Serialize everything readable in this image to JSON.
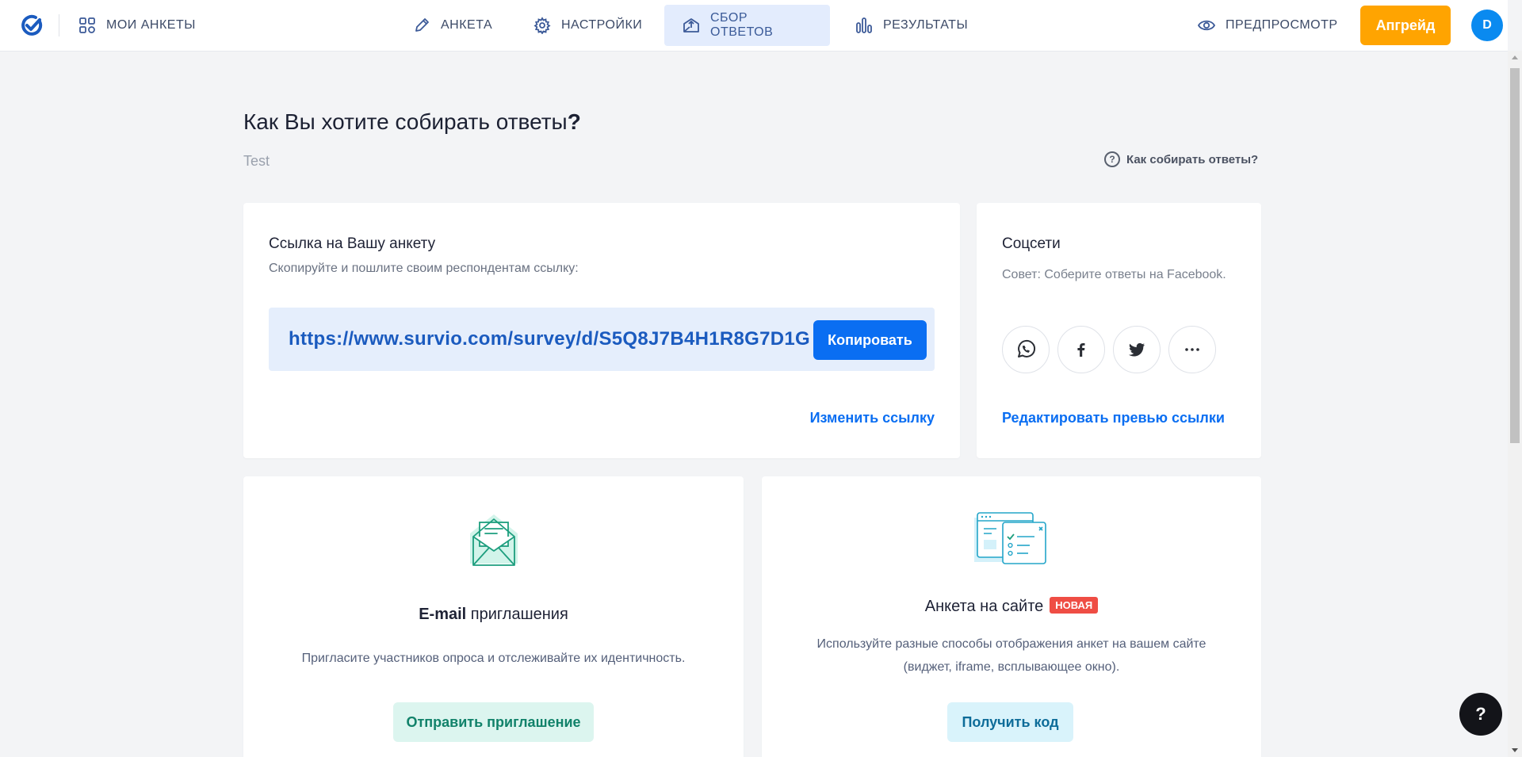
{
  "nav": {
    "my_surveys": "МОИ АНКЕТЫ",
    "tabs": [
      {
        "label": "АНКЕТА"
      },
      {
        "label": "НАСТРОЙКИ"
      },
      {
        "label": "СБОР ОТВЕТОВ"
      },
      {
        "label": "РЕЗУЛЬТАТЫ"
      }
    ],
    "active_tab": "СБОР ОТВЕТОВ",
    "preview": "ПРЕДПРОСМОТР",
    "upgrade": "Апгрейд",
    "avatar_initial": "D"
  },
  "page": {
    "title": "Как Вы хотите собирать ответы",
    "title_mark": "?",
    "survey_name": "Test",
    "help_link": "Как собирать ответы?",
    "help_symbol": "?"
  },
  "link_card": {
    "title": "Ссылка на Вашу анкету",
    "subtitle": "Скопируйте и пошлите своим респондентам ссылку:",
    "url": "https://www.survio.com/survey/d/S5Q8J7B4H1R8G7D1G",
    "copy_label": "Копировать",
    "edit_label": "Изменить ссылку"
  },
  "social_card": {
    "title": "Соцсети",
    "tip": "Совет: Соберите ответы на Facebook.",
    "networks": [
      "whatsapp-icon",
      "facebook-icon",
      "twitter-icon",
      "more-icon"
    ],
    "edit_preview_label": "Редактировать превью ссылки"
  },
  "email_card": {
    "title_bold": "E-mail",
    "title_rest": " приглашения",
    "description": "Пригласите участников опроса и отслеживайте их идентичность.",
    "button_label": "Отправить приглашение"
  },
  "site_card": {
    "title": "Анкета на сайте",
    "badge": "НОВАЯ",
    "description_line1": "Используйте разные способы отображения анкет на вашем сайте",
    "description_line2": "(виджет, iframe, всплывающее окно).",
    "button_label": "Получить код"
  },
  "fab": {
    "label": "?"
  },
  "colors": {
    "accent_blue": "#0a6ef2",
    "upgrade_orange": "#ffa401",
    "badge_red": "#ef4d44",
    "email_green": "#11826a",
    "site_teal": "#0d6c99"
  }
}
